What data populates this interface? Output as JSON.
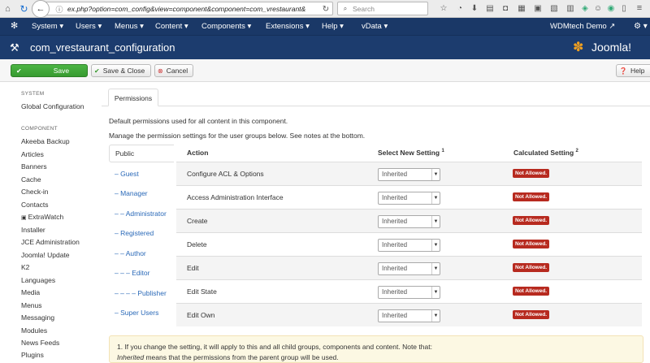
{
  "browser": {
    "url": "ex.php?option=com_config&view=component&component=com_vrestaurant&",
    "search_placeholder": "Search"
  },
  "menubar": {
    "items": [
      "System",
      "Users",
      "Menus",
      "Content",
      "Components",
      "Extensions",
      "Help",
      "vData"
    ],
    "site_name": "WDMtech Demo"
  },
  "header": {
    "title": "com_vrestaurant_configuration",
    "logo_text": "Joomla!"
  },
  "toolbar": {
    "save": "Save",
    "save_close": "Save & Close",
    "cancel": "Cancel",
    "help": "Help"
  },
  "sidebar": {
    "system_heading": "SYSTEM",
    "global_config": "Global Configuration",
    "component_heading": "COMPONENT",
    "components": [
      "Akeeba Backup",
      "Articles",
      "Banners",
      "Cache",
      "Check-in",
      "Contacts",
      "ExtraWatch",
      "Installer",
      "JCE Administration",
      "Joomla! Update",
      "K2",
      "Languages",
      "Media",
      "Menus",
      "Messaging",
      "Modules",
      "News Feeds",
      "Plugins"
    ]
  },
  "content": {
    "tab_label": "Permissions",
    "intro1": "Default permissions used for all content in this component.",
    "intro2": "Manage the permission settings for the user groups below. See notes at the bottom.",
    "groups": [
      "Public",
      "– Guest",
      "– Manager",
      "– – Administrator",
      "– Registered",
      "– – Author",
      "– – – Editor",
      "– – – – Publisher",
      "– Super Users"
    ],
    "col_action": "Action",
    "col_setting": "Select New Setting",
    "col_setting_sup": "1",
    "col_calculated": "Calculated Setting",
    "col_calculated_sup": "2",
    "rows": [
      {
        "action": "Configure ACL & Options",
        "setting": "Inherited",
        "calculated": "Not Allowed."
      },
      {
        "action": "Access Administration Interface",
        "setting": "Inherited",
        "calculated": "Not Allowed."
      },
      {
        "action": "Create",
        "setting": "Inherited",
        "calculated": "Not Allowed."
      },
      {
        "action": "Delete",
        "setting": "Inherited",
        "calculated": "Not Allowed."
      },
      {
        "action": "Edit",
        "setting": "Inherited",
        "calculated": "Not Allowed."
      },
      {
        "action": "Edit State",
        "setting": "Inherited",
        "calculated": "Not Allowed."
      },
      {
        "action": "Edit Own",
        "setting": "Inherited",
        "calculated": "Not Allowed."
      }
    ],
    "note1": "1. If you change the setting, it will apply to this and all child groups, components and content. Note that:",
    "note2_em": "Inherited",
    "note2_rest": " means that the permissions from the parent group will be used."
  },
  "colors": {
    "menubar": "#1a3867",
    "save_button": "#3d9a35",
    "badge": "#b72a1f"
  }
}
